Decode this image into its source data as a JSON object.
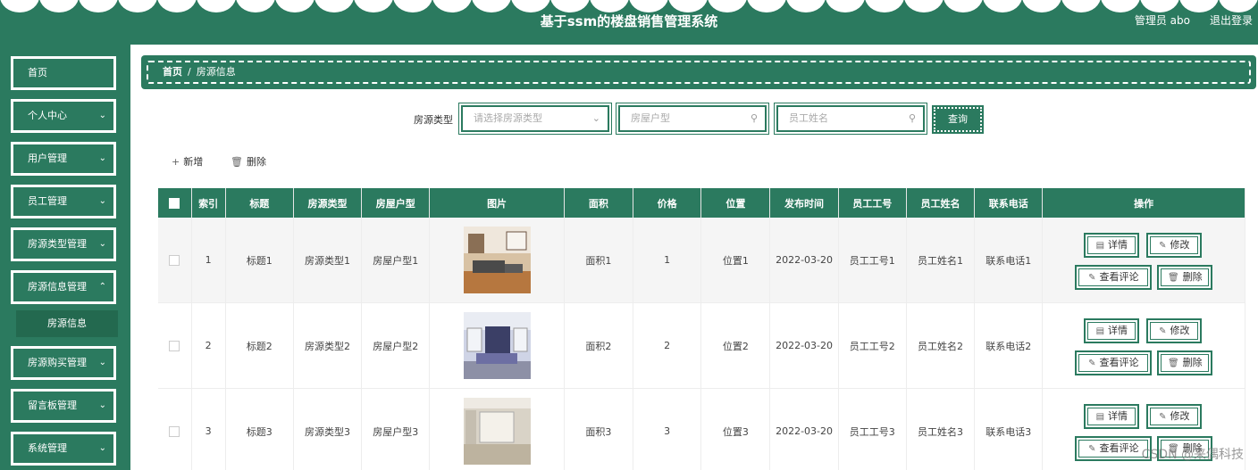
{
  "header": {
    "title": "基于ssm的楼盘销售管理系统",
    "user": "管理员 abo",
    "logout": "退出登录"
  },
  "sidebar": {
    "items": [
      {
        "label": "首页",
        "has_children": false
      },
      {
        "label": "个人中心",
        "has_children": true
      },
      {
        "label": "用户管理",
        "has_children": true
      },
      {
        "label": "员工管理",
        "has_children": true
      },
      {
        "label": "房源类型管理",
        "has_children": true
      },
      {
        "label": "房源信息管理",
        "has_children": true
      },
      {
        "label": "房源购买管理",
        "has_children": true
      },
      {
        "label": "留言板管理",
        "has_children": true
      },
      {
        "label": "系统管理",
        "has_children": true
      }
    ],
    "active_sub": "房源信息"
  },
  "breadcrumb": {
    "home": "首页",
    "separator": "/",
    "current": "房源信息"
  },
  "search": {
    "label": "房源类型",
    "type_placeholder": "请选择房源类型",
    "layout_placeholder": "房屋户型",
    "staff_placeholder": "员工姓名",
    "query_label": "查询"
  },
  "toolbar": {
    "add_label": "新增",
    "delete_label": "删除"
  },
  "table": {
    "headers": [
      "索引",
      "标题",
      "房源类型",
      "房屋户型",
      "图片",
      "面积",
      "价格",
      "位置",
      "发布时间",
      "员工工号",
      "员工姓名",
      "联系电话",
      "操作"
    ],
    "rows": [
      {
        "index": "1",
        "title": "标题1",
        "type": "房源类型1",
        "layout": "房屋户型1",
        "area": "面积1",
        "price": "1",
        "location": "位置1",
        "date": "2022-03-20",
        "staff_no": "员工工号1",
        "staff_name": "员工姓名1",
        "phone": "联系电话1"
      },
      {
        "index": "2",
        "title": "标题2",
        "type": "房源类型2",
        "layout": "房屋户型2",
        "area": "面积2",
        "price": "2",
        "location": "位置2",
        "date": "2022-03-20",
        "staff_no": "员工工号2",
        "staff_name": "员工姓名2",
        "phone": "联系电话2"
      },
      {
        "index": "3",
        "title": "标题3",
        "type": "房源类型3",
        "layout": "房屋户型3",
        "area": "面积3",
        "price": "3",
        "location": "位置3",
        "date": "2022-03-20",
        "staff_no": "员工工号3",
        "staff_name": "员工姓名3",
        "phone": "联系电话3"
      }
    ],
    "actions": {
      "detail": "详情",
      "edit": "修改",
      "comments": "查看评论",
      "delete": "删除"
    }
  },
  "watermark": "CSDN @来偶科技",
  "colors": {
    "primary": "#2b7a5f",
    "header_text": "#ffffff"
  }
}
